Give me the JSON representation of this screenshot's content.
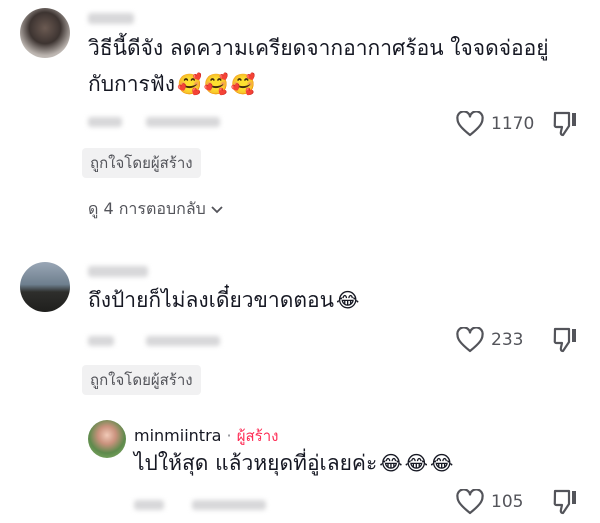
{
  "comments": [
    {
      "text_line1": "วิธีนี้ดีจัง ลดความเครียดจากอากาศร้อน ใจจดจ่ออยู่",
      "text_line2": "กับการฟัง",
      "emojis": [
        "🥰",
        "🥰",
        "🥰"
      ],
      "likes": "1170",
      "liked_by_creator": "ถูกใจโดยผู้สร้าง",
      "view_replies": "ดู 4 การตอบกลับ"
    },
    {
      "text": "ถึงป้ายก็ไม่ลงเดี๋ยวขาดตอน",
      "emojis": [
        "😂"
      ],
      "likes": "233",
      "liked_by_creator": "ถูกใจโดยผู้สร้าง"
    }
  ],
  "reply": {
    "username": "minmiintra",
    "separator": "·",
    "creator_tag": "ผู้สร้าง",
    "text": "ไปให้สุด แล้วหยุดที่อู่เลยค่ะ",
    "emojis": [
      "😂",
      "😂",
      "😂"
    ],
    "likes": "105"
  },
  "icons": [
    "heart-outline-icon",
    "dislike-icon",
    "chevron-down-icon"
  ],
  "colors": {
    "text": "#161823",
    "secondary": "#8a8b91",
    "creator": "#fe2c55",
    "chip_bg": "#f1f1f2"
  }
}
